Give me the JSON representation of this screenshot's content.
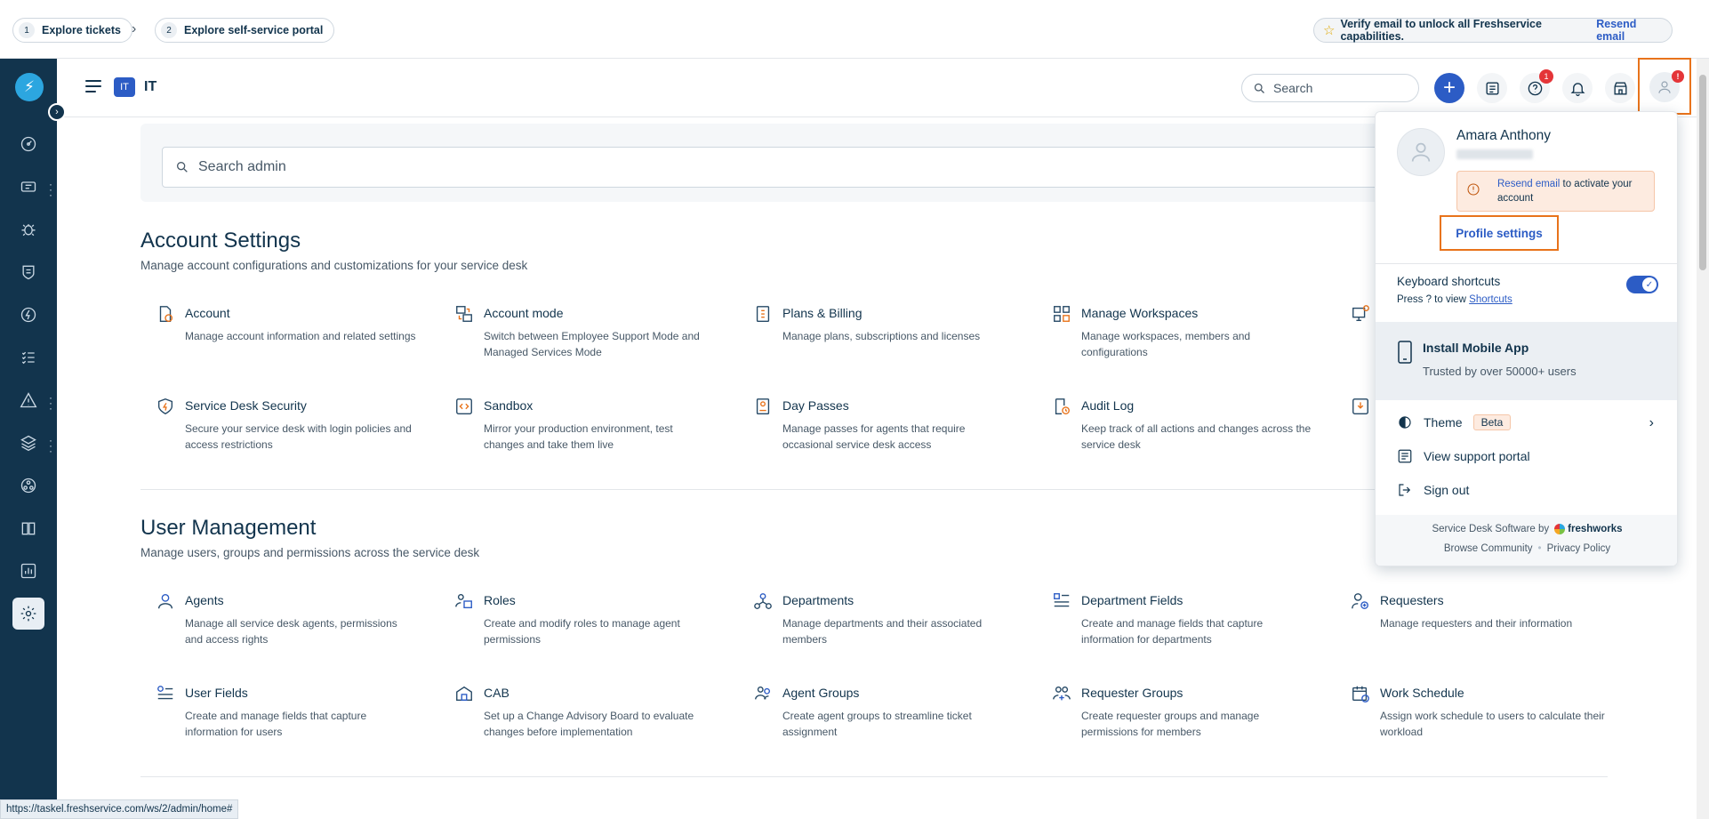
{
  "onboarding": {
    "steps": [
      {
        "num": "1",
        "label": "Explore tickets"
      },
      {
        "num": "2",
        "label": "Explore self-service portal"
      }
    ],
    "verify_text": "Verify email to unlock all Freshservice capabilities.",
    "verify_link": "Resend email"
  },
  "header": {
    "workspace_badge": "IT",
    "workspace_name": "IT",
    "search_placeholder": "Search",
    "help_badge": "1",
    "avatar_alert": "!"
  },
  "admin": {
    "search_placeholder": "Search admin"
  },
  "sections": [
    {
      "title": "Account Settings",
      "subtitle": "Manage account configurations and customizations for your service desk",
      "items": [
        {
          "title": "Account",
          "desc": "Manage account information and related settings"
        },
        {
          "title": "Account mode",
          "desc": "Switch between Employee Support Mode and Managed Services Mode"
        },
        {
          "title": "Plans & Billing",
          "desc": "Manage plans, subscriptions and licenses"
        },
        {
          "title": "Manage Workspaces",
          "desc": "Manage workspaces, members and configurations"
        },
        {
          "title": "Service Desk Security",
          "desc": "Secure your service desk with login policies and access restrictions"
        },
        {
          "title": "Sandbox",
          "desc": "Mirror your production environment, test changes and take them live"
        },
        {
          "title": "Day Passes",
          "desc": "Manage passes for agents that require occasional service desk access"
        },
        {
          "title": "Audit Log",
          "desc": "Keep track of all actions and changes across the service desk"
        }
      ]
    },
    {
      "title": "User Management",
      "subtitle": "Manage users, groups and permissions across the service desk",
      "items": [
        {
          "title": "Agents",
          "desc": "Manage all service desk agents, permissions and access rights"
        },
        {
          "title": "Roles",
          "desc": "Create and modify roles to manage agent permissions"
        },
        {
          "title": "Departments",
          "desc": "Manage departments and their associated members"
        },
        {
          "title": "Department Fields",
          "desc": "Create and manage fields that capture information for departments"
        },
        {
          "title": "Requesters",
          "desc": "Manage requesters and their information"
        },
        {
          "title": "User Fields",
          "desc": "Create and manage fields that capture information for users"
        },
        {
          "title": "CAB",
          "desc": "Set up a Change Advisory Board to evaluate changes before implementation"
        },
        {
          "title": "Agent Groups",
          "desc": "Create agent groups to streamline ticket assignment"
        },
        {
          "title": "Requester Groups",
          "desc": "Create requester groups and manage permissions for members"
        },
        {
          "title": "Work Schedule",
          "desc": "Assign work schedule to users to calculate their workload"
        }
      ]
    }
  ],
  "profile_menu": {
    "name": "Amara Anthony",
    "warning_link": "Resend email",
    "warning_text": " to activate your account",
    "profile_settings": "Profile settings",
    "keyboard_shortcuts": "Keyboard shortcuts",
    "shortcuts_hint": "Press ? to view ",
    "shortcuts_link": "Shortcuts",
    "mobile_title": "Install Mobile App",
    "mobile_sub": "Trusted by over 50000+ users",
    "theme": "Theme",
    "theme_badge": "Beta",
    "support_portal": "View support portal",
    "sign_out": "Sign out",
    "footer_text": "Service Desk Software by",
    "footer_brand": "freshworks",
    "browse_community": "Browse Community",
    "privacy_policy": "Privacy Policy"
  },
  "status_url": "https://taskel.freshservice.com/ws/2/admin/home#"
}
